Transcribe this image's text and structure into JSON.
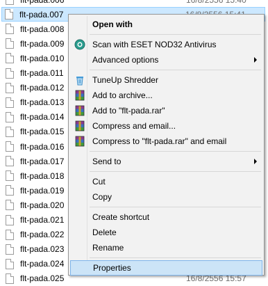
{
  "files": [
    {
      "name": "flt-pada.006",
      "date": "16/8/2556 15:40",
      "selected": false
    },
    {
      "name": "flt-pada.007",
      "date": "16/8/2556 15:41",
      "selected": true
    },
    {
      "name": "flt-pada.008",
      "date": "",
      "selected": false
    },
    {
      "name": "flt-pada.009",
      "date": "",
      "selected": false
    },
    {
      "name": "flt-pada.010",
      "date": "",
      "selected": false
    },
    {
      "name": "flt-pada.011",
      "date": "",
      "selected": false
    },
    {
      "name": "flt-pada.012",
      "date": "",
      "selected": false
    },
    {
      "name": "flt-pada.013",
      "date": "",
      "selected": false
    },
    {
      "name": "flt-pada.014",
      "date": "",
      "selected": false
    },
    {
      "name": "flt-pada.015",
      "date": "",
      "selected": false
    },
    {
      "name": "flt-pada.016",
      "date": "",
      "selected": false
    },
    {
      "name": "flt-pada.017",
      "date": "",
      "selected": false
    },
    {
      "name": "flt-pada.018",
      "date": "",
      "selected": false
    },
    {
      "name": "flt-pada.019",
      "date": "",
      "selected": false
    },
    {
      "name": "flt-pada.020",
      "date": "",
      "selected": false
    },
    {
      "name": "flt-pada.021",
      "date": "",
      "selected": false
    },
    {
      "name": "flt-pada.022",
      "date": "",
      "selected": false
    },
    {
      "name": "flt-pada.023",
      "date": "",
      "selected": false
    },
    {
      "name": "flt-pada.024",
      "date": "",
      "selected": false
    },
    {
      "name": "flt-pada.025",
      "date": "16/8/2556 15:57",
      "selected": false
    }
  ],
  "context_menu": {
    "items": [
      {
        "label": "Open with",
        "bold": true,
        "icon": "",
        "submenu": false
      },
      {
        "sep": true
      },
      {
        "label": "Scan with ESET NOD32 Antivirus",
        "icon": "eset-icon",
        "submenu": false
      },
      {
        "label": "Advanced options",
        "icon": "",
        "submenu": true
      },
      {
        "sep": true
      },
      {
        "label": "TuneUp Shredder",
        "icon": "shredder-icon",
        "submenu": false
      },
      {
        "label": "Add to archive...",
        "icon": "winrar-icon",
        "submenu": false
      },
      {
        "label": "Add to \"flt-pada.rar\"",
        "icon": "winrar-icon",
        "submenu": false
      },
      {
        "label": "Compress and email...",
        "icon": "winrar-icon",
        "submenu": false
      },
      {
        "label": "Compress to \"flt-pada.rar\" and email",
        "icon": "winrar-icon",
        "submenu": false
      },
      {
        "sep": true
      },
      {
        "label": "Send to",
        "icon": "",
        "submenu": true
      },
      {
        "sep": true
      },
      {
        "label": "Cut",
        "icon": "",
        "submenu": false
      },
      {
        "label": "Copy",
        "icon": "",
        "submenu": false
      },
      {
        "sep": true
      },
      {
        "label": "Create shortcut",
        "icon": "",
        "submenu": false
      },
      {
        "label": "Delete",
        "icon": "",
        "submenu": false
      },
      {
        "label": "Rename",
        "icon": "",
        "submenu": false
      },
      {
        "sep": true
      },
      {
        "label": "Properties",
        "icon": "",
        "submenu": false,
        "highlighted": true
      }
    ]
  },
  "colors": {
    "selection_bg": "#cce8ff",
    "menu_bg": "#f2f2f2",
    "menu_highlight": "#cce4f7",
    "date_text": "#6d6d6d"
  }
}
